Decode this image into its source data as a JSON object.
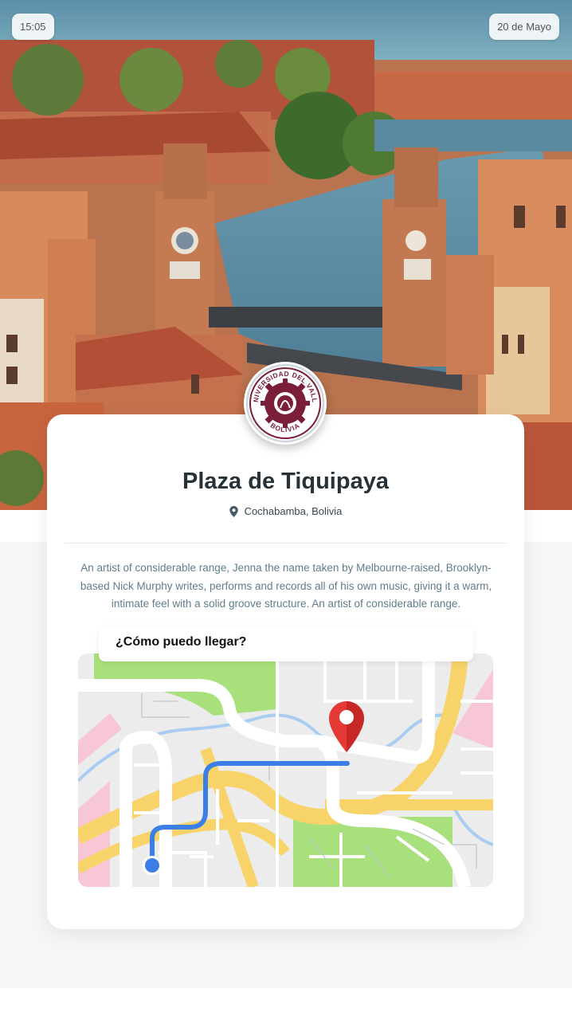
{
  "status": {
    "time": "15:05",
    "date": "20 de Mayo"
  },
  "hero": {
    "image_subject": "aerial-city-canal-towers"
  },
  "logo": {
    "top_text": "UNIVERSIDAD DEL VALLE",
    "bottom_text": "BOLIVIA"
  },
  "place": {
    "title": "Plaza de Tiquipaya",
    "location": "Cochabamba, Bolivia",
    "description": "An artist of considerable range, Jenna the name taken by Melbourne-raised, Brooklyn-based Nick Murphy writes, performs and records all of his own music, giving it a warm, intimate feel with a solid groove structure. An artist of considerable range."
  },
  "directions": {
    "heading": "¿Cómo puedo llegar?"
  },
  "colors": {
    "route": "#3b7fe6",
    "pin": "#e53935",
    "brand": "#7a1e3a"
  }
}
